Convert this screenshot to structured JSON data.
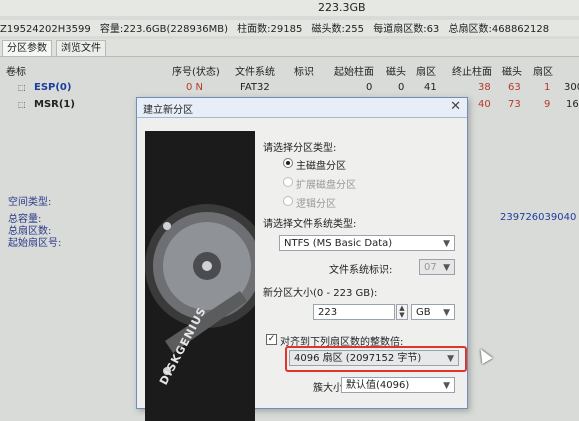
{
  "window": {
    "disk_capacity": "223.3GB"
  },
  "disk_info": {
    "serial": "Z19524202H3599",
    "capacity": "容量:223.6GB(228936MB)",
    "cylinders": "柱面数:29185",
    "heads": "磁头数:255",
    "sectors_per_track": "每道扇区数:63",
    "total_sectors": "总扇区数:468862128"
  },
  "tabs": [
    {
      "label": "分区参数"
    },
    {
      "label": "浏览文件"
    }
  ],
  "table": {
    "headers": [
      "卷标",
      "序号(状态)",
      "文件系统",
      "标识",
      "起始柱面",
      "磁头",
      "扇区",
      "终止柱面",
      "磁头",
      "扇区"
    ],
    "rows": [
      {
        "label": "ESP(0)",
        "seq": "0 N",
        "fs": "FAT32",
        "start_cyl": "0",
        "start_head": "0",
        "start_sec": "41",
        "end_cyl": "38",
        "end_head": "63",
        "end_sec": "1",
        "extra": "300"
      },
      {
        "label": "MSR(1)",
        "seq": "",
        "fs": "",
        "start_cyl": "",
        "start_head": "",
        "start_sec": "",
        "end_cyl": "40",
        "end_head": "73",
        "end_sec": "9",
        "extra": "16"
      }
    ]
  },
  "left_info": {
    "space_type": "空间类型:",
    "total_capacity": "总容量:",
    "total_sectors": "总扇区数:",
    "start_sector": "起始扇区号:",
    "sector_value": "239726039040"
  },
  "dialog": {
    "title": "建立新分区",
    "partition_type_label": "请选择分区类型:",
    "partition_types": [
      "主磁盘分区",
      "扩展磁盘分区",
      "逻辑分区"
    ],
    "fs_type_label": "请选择文件系统类型:",
    "fs_type_value": "NTFS (MS Basic Data)",
    "fs_id_label": "文件系统标识:",
    "fs_id_value": "07",
    "size_label": "新分区大小(0 - 223 GB):",
    "size_value": "223",
    "size_unit": "GB",
    "align_label": "对齐到下列扇区数的整数倍:",
    "align_checked": true,
    "align_value": "4096 扇区 (2097152 字节)",
    "cluster_label": "簇大小:",
    "cluster_value": "默认值(4096)",
    "brand_text": "DISKGENIUS"
  },
  "colors": {
    "highlight": "#e0352b",
    "accent_blue": "#1d3d9e",
    "red_text": "#b53a2a"
  }
}
